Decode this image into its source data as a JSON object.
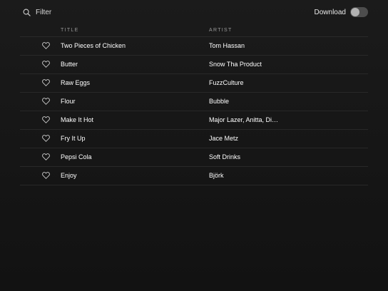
{
  "filter": {
    "placeholder": "Filter",
    "icon": "search-icon"
  },
  "download": {
    "label": "Download",
    "enabled": false
  },
  "columns": {
    "title": "TITLE",
    "artist": "ARTIST"
  },
  "tracks": [
    {
      "title": "Two Pieces of Chicken",
      "artist": "Tom Hassan",
      "liked": false
    },
    {
      "title": "Butter",
      "artist": "Snow Tha Product",
      "liked": false
    },
    {
      "title": "Raw Eggs",
      "artist": "FuzzCulture",
      "liked": false
    },
    {
      "title": "Flour",
      "artist": "Bubble",
      "liked": false
    },
    {
      "title": "Make It Hot",
      "artist": "Major Lazer, Anitta, Di…",
      "liked": false
    },
    {
      "title": "Fry It Up",
      "artist": "Jace Metz",
      "liked": false
    },
    {
      "title": "Pepsi Cola",
      "artist": "Soft Drinks",
      "liked": false
    },
    {
      "title": "Enjoy",
      "artist": "Björk",
      "liked": false
    }
  ],
  "colors": {
    "background": "#181818",
    "divider": "#282828",
    "muted_text": "#9a9a9a",
    "toggle_off": "#4d4d4d"
  }
}
